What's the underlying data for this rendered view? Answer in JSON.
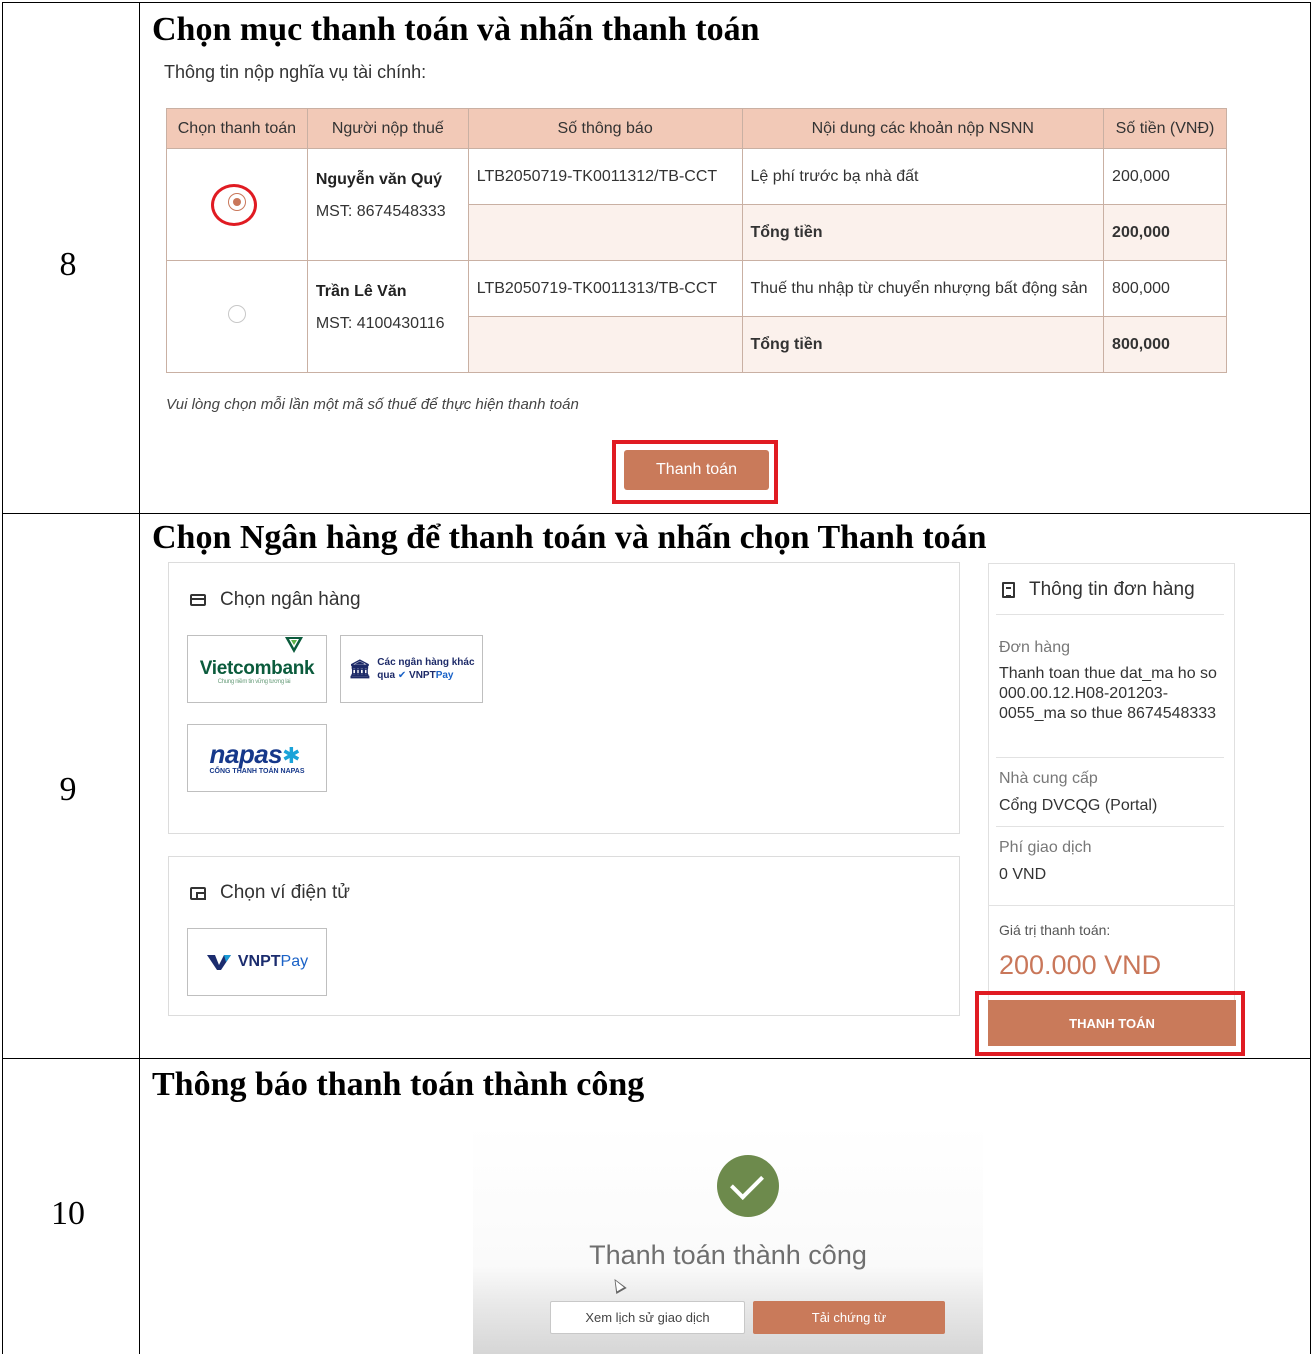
{
  "steps": [
    {
      "number": "8",
      "heading": "Chọn mục thanh toán và nhấn thanh toán"
    },
    {
      "number": "9",
      "heading": "Chọn Ngân hàng để thanh toán và nhấn chọn Thanh toán"
    },
    {
      "number": "10",
      "heading": "Thông báo thanh toán thành công"
    }
  ],
  "step8": {
    "subtitle": "Thông tin nộp nghĩa vụ tài chính:",
    "columns": [
      "Chọn thanh toán",
      "Người nộp thuế",
      "Số thông báo",
      "Nội dung các khoản nộp NSNN",
      "Số tiền (VNĐ)"
    ],
    "rows": [
      {
        "selected": true,
        "name": "Nguyễn văn Quý",
        "mst": "MST: 8674548333",
        "notice": "LTB2050719-TK0011312/TB-CCT",
        "content": "Lệ phí trước bạ nhà đất",
        "amount": "200,000",
        "total_label": "Tổng tiền",
        "total": "200,000"
      },
      {
        "selected": false,
        "name": "Trần Lê Văn",
        "mst": "MST: 4100430116",
        "notice": "LTB2050719-TK0011313/TB-CCT",
        "content": "Thuế thu nhập từ chuyển nhượng bất động sản",
        "amount": "800,000",
        "total_label": "Tổng tiền",
        "total": "800,000"
      }
    ],
    "note": "Vui lòng chọn mỗi lần một mã số thuế để thực hiện thanh toán",
    "pay_button": "Thanh toán",
    "highlight_color": "#e01b22",
    "accent_color": "#c97a5a"
  },
  "step9": {
    "bank_title": "Chọn ngân hàng",
    "banks": {
      "vietcombank": "Vietcombank",
      "vietcombank_tagline": "Chung niềm tin vững tương lai",
      "other_line1": "Các ngân hàng khác",
      "other_line2": "qua",
      "other_brand": "VNPT",
      "other_brand2": "Pay",
      "napas": "napas",
      "napas_sub": "CỔNG THANH TOÁN NAPAS"
    },
    "wallet_title": "Chọn ví điện tử",
    "wallet": {
      "brand": "VNPT",
      "brand2": "Pay"
    },
    "order": {
      "title": "Thông tin đơn hàng",
      "label_order": "Đơn hàng",
      "order_value": "Thanh toan thue dat_ma ho so 000.00.12.H08-201203-0055_ma so thue 8674548333",
      "label_provider": "Nhà cung cấp",
      "provider": "Cổng DVCQG (Portal)",
      "label_fee": "Phí giao dịch",
      "fee": "0 VND",
      "label_total": "Giá trị thanh toán:",
      "total": "200.000 VND",
      "button": "THANH TOÁN"
    }
  },
  "step10": {
    "message": "Thanh toán thành công",
    "history_button": "Xem lịch sử giao dịch",
    "download_button": "Tải chứng từ",
    "success_color": "#6d8a4c"
  }
}
